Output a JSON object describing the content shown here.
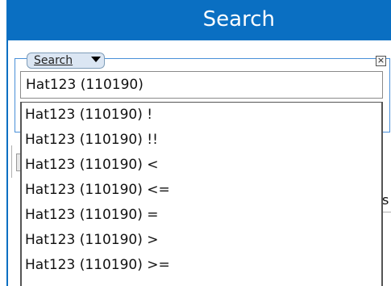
{
  "header": {
    "title": "Search"
  },
  "search_panel": {
    "mode_dropdown": "Search",
    "clear_symbol": "×",
    "input_value": "Hat123 (110190) "
  },
  "suggestions": [
    "Hat123 (110190) !",
    "Hat123 (110190) !!",
    "Hat123 (110190) <",
    "Hat123 (110190) <=",
    "Hat123 (110190) =",
    "Hat123 (110190) >",
    "Hat123 (110190) >="
  ],
  "background_fragment_text": "s",
  "colors": {
    "header_bg": "#0a6fc2",
    "group_border": "#4a90d9",
    "dropdown_bg": "#dbe6f3"
  },
  "icons": {
    "mode_dropdown": "chevron-down-icon",
    "clear": "close-icon"
  }
}
